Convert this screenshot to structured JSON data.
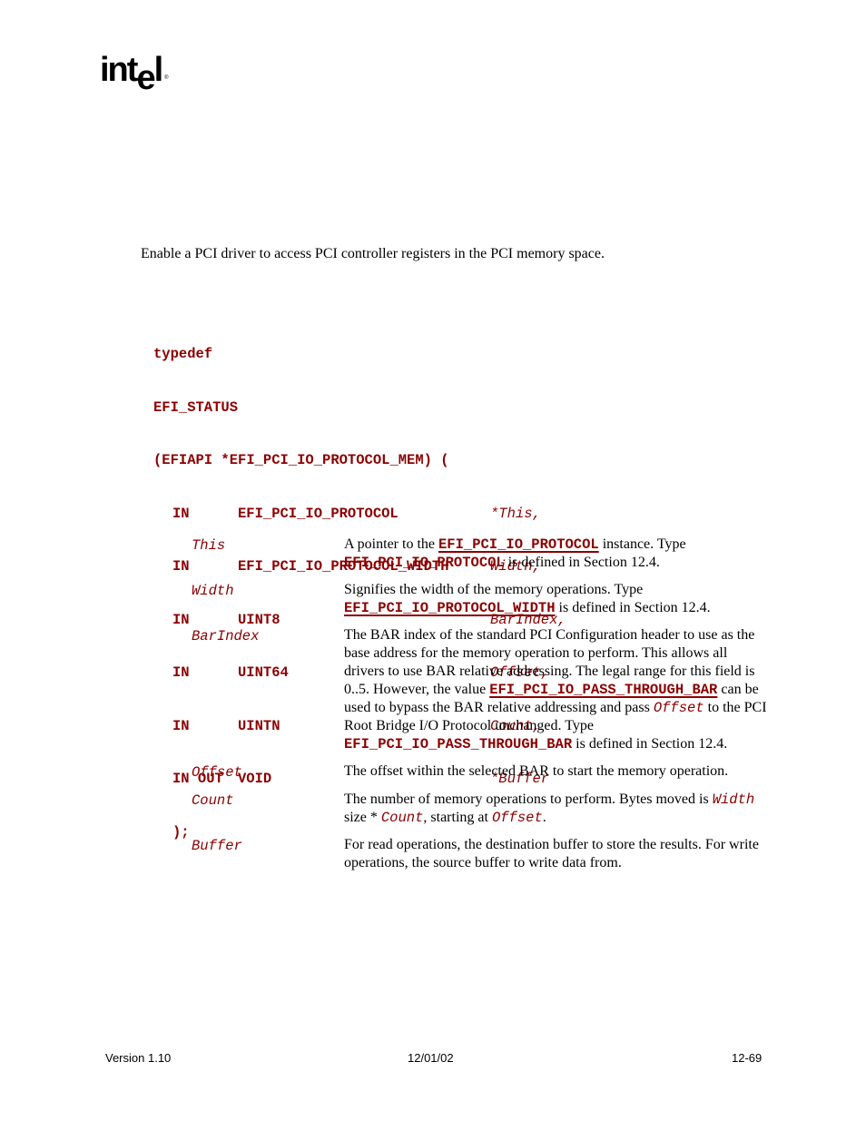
{
  "header": {
    "logo": {
      "prefix": "int",
      "e": "e",
      "suffix": "l",
      "registered": "®"
    }
  },
  "summary": "Enable a PCI driver to access PCI controller registers in the PCI memory space.",
  "prototype": {
    "line1": "typedef",
    "line2": "EFI_STATUS",
    "line3": "(EFIAPI *EFI_PCI_IO_PROTOCOL_MEM) (",
    "args": [
      {
        "dir": "IN",
        "type": "EFI_PCI_IO_PROTOCOL",
        "name": "*This,"
      },
      {
        "dir": "IN",
        "type": "EFI_PCI_IO_PROTOCOL_WIDTH",
        "name": "Width,"
      },
      {
        "dir": "IN",
        "type": "UINT8",
        "name": "BarIndex,"
      },
      {
        "dir": "IN",
        "type": "UINT64",
        "name": "Offset,"
      },
      {
        "dir": "IN",
        "type": "UINTN",
        "name": "Count,"
      },
      {
        "dir": "IN OUT",
        "type": "VOID",
        "name": "*Buffer"
      }
    ],
    "close": ");"
  },
  "parameters": {
    "this": {
      "name": "This",
      "t1": "A pointer to the ",
      "link": "EFI_PCI_IO_PROTOCOL",
      "t2": " instance.  Type ",
      "code": "EFI_PCI_IO_PROTOCOL",
      "t3": " is defined in Section 12.4."
    },
    "width": {
      "name": "Width",
      "t1": "Signifies the width of the memory operations.  Type ",
      "link": "EFI_PCI_IO_PROTOCOL_WIDTH",
      "t2": " is defined in Section 12.4."
    },
    "barindex": {
      "name": "BarIndex",
      "t1": "The BAR index of the standard PCI Configuration header to use as the base address for the memory operation to perform.  This allows all drivers to use BAR relative addressing.  The legal range for this field is 0..5.  However, the value ",
      "link": "EFI_PCI_IO_PASS_THROUGH_BAR",
      "t2": " can be used to bypass the BAR relative addressing and pass ",
      "code_italic": "Offset",
      "t3": " to the PCI Root Bridge I/O Protocol unchanged.  Type ",
      "code": "EFI_PCI_IO_PASS_THROUGH_BAR",
      "t4": " is defined in Section 12.4."
    },
    "offset": {
      "name": "Offset",
      "t1": "The offset within the selected BAR to start the memory operation."
    },
    "count": {
      "name": "Count",
      "t1": "The number of memory operations to perform.  Bytes moved is ",
      "c1": "Width",
      "t2": " size * ",
      "c2": "Count",
      "t3": ", starting at ",
      "c3": "Offset",
      "t4": "."
    },
    "buffer": {
      "name": "Buffer",
      "t1": "For read operations, the destination buffer to store the results.  For write operations, the source buffer to write data from."
    }
  },
  "footer": {
    "version": "Version 1.10",
    "date": "12/01/02",
    "page": "12-69"
  }
}
